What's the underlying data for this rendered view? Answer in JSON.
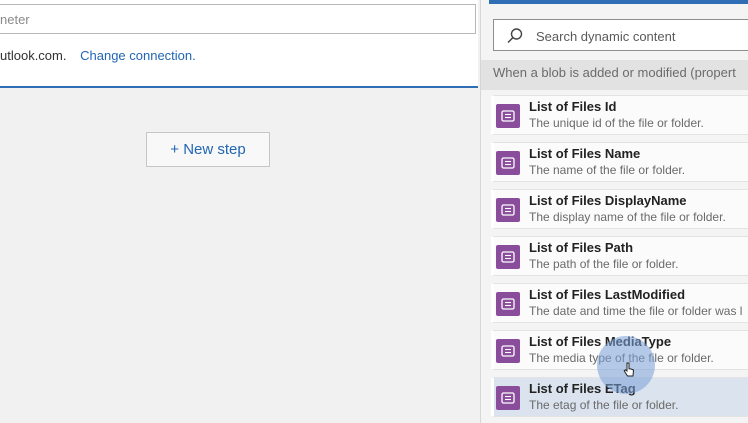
{
  "action": {
    "param_label": "neter",
    "connection_text": "utlook.com.",
    "change_connection_label": "Change connection."
  },
  "new_step_label": "+ New step",
  "panel": {
    "search_placeholder": "Search dynamic content",
    "section_header": "When a blob is added or modified (propert",
    "items": [
      {
        "name": "List of Files Id",
        "desc": "The unique id of the file or folder."
      },
      {
        "name": "List of Files Name",
        "desc": "The name of the file or folder."
      },
      {
        "name": "List of Files DisplayName",
        "desc": "The display name of the file or folder."
      },
      {
        "name": "List of Files Path",
        "desc": "The path of the file or folder."
      },
      {
        "name": "List of Files LastModified",
        "desc": "The date and time the file or folder was l"
      },
      {
        "name": "List of Files MediaType",
        "desc": "The media type of the file or folder."
      },
      {
        "name": "List of Files ETag",
        "desc": "The etag of the file or folder."
      }
    ]
  },
  "colors": {
    "accent": "#2f6db5",
    "link": "#2266b3",
    "blob_icon": "#8a4d9c"
  }
}
